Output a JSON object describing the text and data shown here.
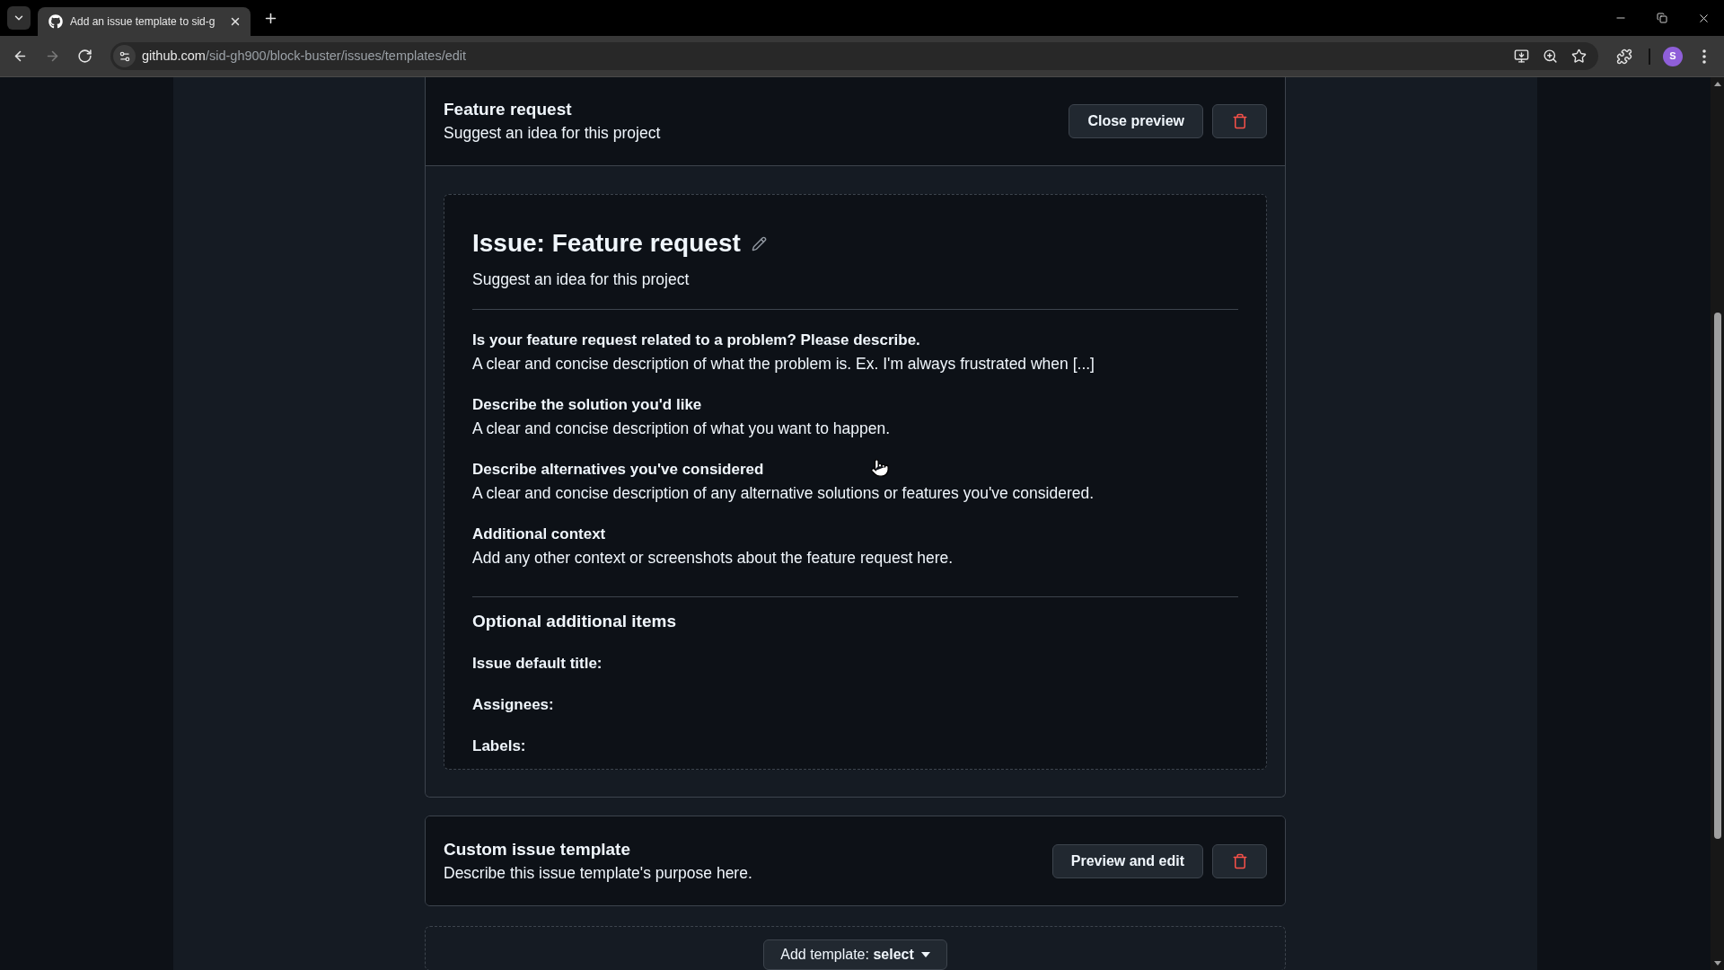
{
  "browser": {
    "tabs": [
      {
        "title": "Add an issue template to sid-g",
        "selected": true
      }
    ],
    "nav_buttons": [
      {
        "kind": "back",
        "disabled": false
      },
      {
        "kind": "forward",
        "disabled": true
      },
      {
        "kind": "reload",
        "disabled": false
      }
    ],
    "address": {
      "host": "github.com",
      "path": "/sid-gh900/block-buster/issues/templates/edit"
    },
    "profile_initial": "S"
  },
  "templates": [
    {
      "title": "Feature request",
      "description": "Suggest an idea for this project",
      "button": "Close preview",
      "preview": {
        "heading": "Issue: Feature request",
        "description": "Suggest an idea for this project",
        "sections": [
          {
            "title": "Is your feature request related to a problem? Please describe.",
            "text": "A clear and concise description of what the problem is. Ex. I'm always frustrated when [...]"
          },
          {
            "title": "Describe the solution you'd like",
            "text": "A clear and concise description of what you want to happen."
          },
          {
            "title": "Describe alternatives you've considered",
            "text": "A clear and concise description of any alternative solutions or features you've considered."
          },
          {
            "title": "Additional context",
            "text": "Add any other context or screenshots about the feature request here."
          }
        ],
        "optional": {
          "heading": "Optional additional items",
          "fields": [
            "Issue default title:",
            "Assignees:",
            "Labels:"
          ]
        }
      }
    },
    {
      "title": "Custom issue template",
      "description": "Describe this issue template's purpose here.",
      "button": "Preview and edit"
    }
  ],
  "add_template": {
    "label": "Add template: **select**"
  }
}
